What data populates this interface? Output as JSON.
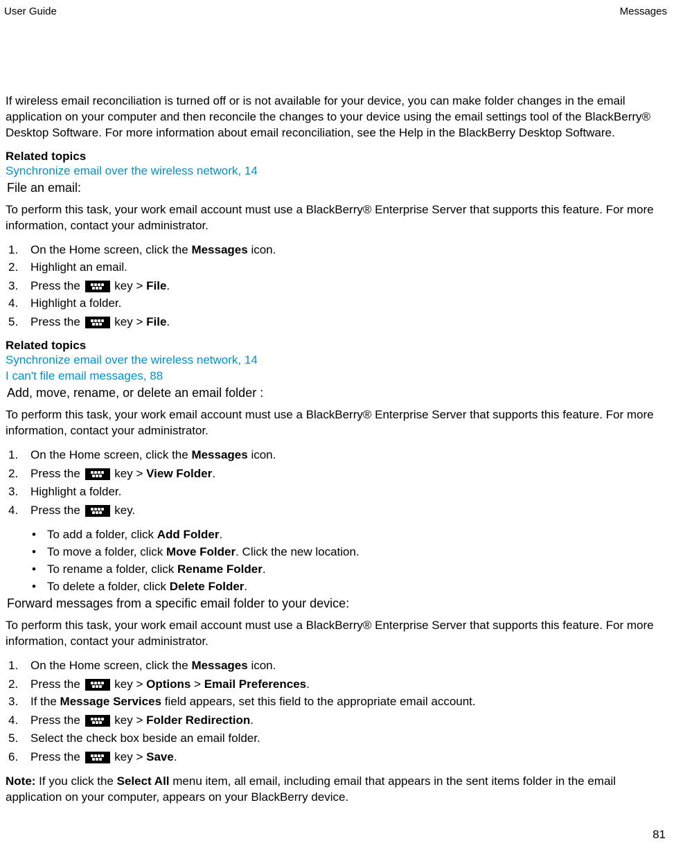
{
  "header": {
    "left": "User Guide",
    "right": "Messages"
  },
  "intro": {
    "p1a": "If wireless email reconciliation is turned off or is not available for your device, you can make folder changes in the email application on your computer and then reconcile the changes to your device using the email settings tool of the BlackBerry® Desktop Software. For more information about email reconciliation, see the Help in the BlackBerry Desktop Software."
  },
  "related1": {
    "label": "Related topics",
    "link1": "Synchronize email over the wireless network, 14"
  },
  "section1": {
    "title": "File an email:",
    "intro": "To perform this task, your work email account must use a BlackBerry® Enterprise Server that supports this feature. For more information, contact your administrator.",
    "steps": {
      "s1a": "On the Home screen, click the ",
      "s1b": "Messages",
      "s1c": " icon.",
      "s2": "Highlight an email.",
      "s3a": "Press the ",
      "s3b": " key > ",
      "s3c": "File",
      "s3d": ".",
      "s4": "Highlight a folder.",
      "s5a": "Press the ",
      "s5b": " key > ",
      "s5c": "File",
      "s5d": "."
    }
  },
  "related2": {
    "label": "Related topics",
    "link1": "Synchronize email over the wireless network, 14",
    "link2": "I can't file email messages, 88"
  },
  "section2": {
    "title": "Add, move, rename, or delete an email folder :",
    "intro": "To perform this task, your work email account must use a BlackBerry® Enterprise Server that supports this feature. For more information, contact your administrator.",
    "steps": {
      "s1a": "On the Home screen, click the ",
      "s1b": "Messages",
      "s1c": " icon.",
      "s2a": "Press the ",
      "s2b": " key > ",
      "s2c": "View Folder",
      "s2d": ".",
      "s3": "Highlight a folder.",
      "s4a": "Press the ",
      "s4b": " key."
    },
    "bullets": {
      "b1a": "To add a folder, click ",
      "b1b": "Add Folder",
      "b1c": ".",
      "b2a": "To move a folder, click ",
      "b2b": "Move Folder",
      "b2c": ". Click the new location.",
      "b3a": "To rename a folder, click ",
      "b3b": "Rename Folder",
      "b3c": ".",
      "b4a": "To delete a folder, click ",
      "b4b": "Delete Folder",
      "b4c": "."
    }
  },
  "section3": {
    "title": "Forward messages from a specific email folder to your device:",
    "intro": "To perform this task, your work email account must use a BlackBerry® Enterprise Server that supports this feature. For more information, contact your administrator.",
    "steps": {
      "s1a": "On the Home screen, click the ",
      "s1b": "Messages",
      "s1c": " icon.",
      "s2a": "Press the ",
      "s2b": " key > ",
      "s2c": "Options",
      "s2d": " > ",
      "s2e": "Email Preferences",
      "s2f": ".",
      "s3a": "If the ",
      "s3b": "Message Services",
      "s3c": " field appears, set this field to the appropriate email account.",
      "s4a": "Press the ",
      "s4b": " key > ",
      "s4c": "Folder Redirection",
      "s4d": ".",
      "s5": "Select the check box beside an email folder.",
      "s6a": "Press the ",
      "s6b": " key > ",
      "s6c": "Save",
      "s6d": "."
    },
    "note": {
      "label": "Note:",
      "text1": " If you click the ",
      "bold1": "Select All",
      "text2": " menu item, all email, including email that appears in the sent items folder in the email application on your computer, appears on your BlackBerry device."
    }
  },
  "pageNumber": "81"
}
